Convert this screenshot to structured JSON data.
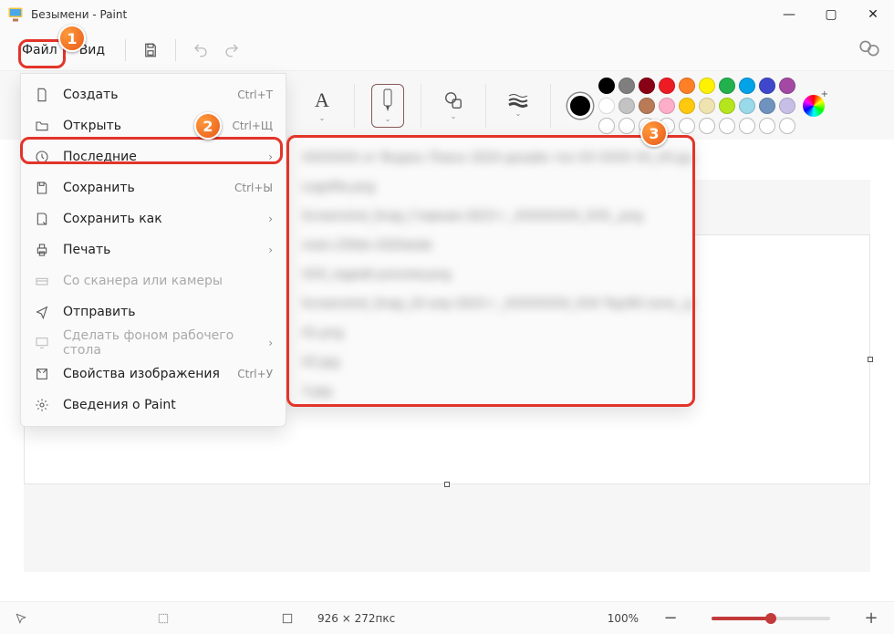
{
  "window": {
    "title": "Безымени - Paint"
  },
  "menu": {
    "file": "Файл",
    "view": "Вид"
  },
  "file_menu": {
    "new": {
      "label": "Создать",
      "shortcut": "Ctrl+Т"
    },
    "open": {
      "label": "Открыть",
      "shortcut": "Ctrl+Щ"
    },
    "recent": {
      "label": "Последние"
    },
    "save": {
      "label": "Сохранить",
      "shortcut": "Ctrl+Ы"
    },
    "save_as": {
      "label": "Сохранить как"
    },
    "print": {
      "label": "Печать"
    },
    "scanner": {
      "label": "Со сканера или камеры"
    },
    "share": {
      "label": "Отправить"
    },
    "wallpaper": {
      "label": "Сделать фоном рабочего стола"
    },
    "props": {
      "label": "Свойства изображения",
      "shortcut": "Ctrl+У"
    },
    "about": {
      "label": "Сведения о Paint"
    }
  },
  "recent_files": [
    "XXXXXXX от Яндекс Поиск 2024 дизайн тел XX XXXX XX_XX.jpg",
    "Logofile.png",
    "Screenshot_Snap_Главная 2023 г._XXXXXXXX_XXX_.png",
    "main-25feb-1920wide",
    "XXX_regedit-preview.png",
    "Screenshot_Snap_24 апр 2023 г._XXXXXXXX_XXX Top/60 zone_.jpg",
    "01.png",
    "02.jpg",
    "3.jpg"
  ],
  "colors": {
    "row1": [
      "#000000",
      "#7f7f7f",
      "#880015",
      "#ed1c24",
      "#ff7f27",
      "#fff200",
      "#22b14c",
      "#00a2e8",
      "#3f48cc",
      "#a349a4"
    ],
    "row2": [
      "#ffffff",
      "#c3c3c3",
      "#b97a57",
      "#ffaec9",
      "#ffc90e",
      "#efe4b0",
      "#b5e61d",
      "#99d9ea",
      "#7092be",
      "#c8bfe7"
    ]
  },
  "status": {
    "canvas_size": "926 × 272пкс",
    "zoom": "100%"
  },
  "annotations": {
    "b1": "1",
    "b2": "2",
    "b3": "3"
  }
}
